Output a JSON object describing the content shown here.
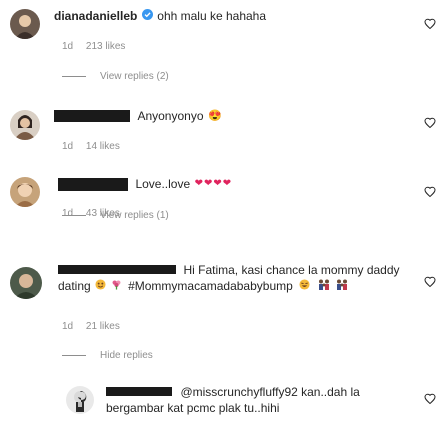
{
  "comments": [
    {
      "username": "dianadanielleb",
      "verified_icon": "verified-badge-icon",
      "text": "ohh malu ke hahaha",
      "time": "1d",
      "likes": "213 likes",
      "view_replies": "View replies (2)"
    },
    {
      "text": "Anyonyonyo",
      "emoji": "😍",
      "time": "1d",
      "likes": "14 likes"
    },
    {
      "text": "Love..love",
      "emoji": "❤❤❤❤",
      "time": "1d",
      "likes": "43 likes",
      "view_replies": "View replies (1)"
    },
    {
      "text_line1": "Hi Fatima, kasi chance la mommy daddy",
      "text_line2_a": "dating",
      "text_line2_b": "#Mommymacamadababybump",
      "time": "1d",
      "likes": "21 likes",
      "hide_replies": "Hide replies"
    },
    {
      "text_line1": "@misscrunchyfluffy92 kan..dah la",
      "text_line2": "bergambar kat pcmc plak tu..hihi"
    }
  ],
  "colors": {
    "meta": "#8e8e8e",
    "heart_red": "#e0245e",
    "verified": "#3897f0"
  }
}
